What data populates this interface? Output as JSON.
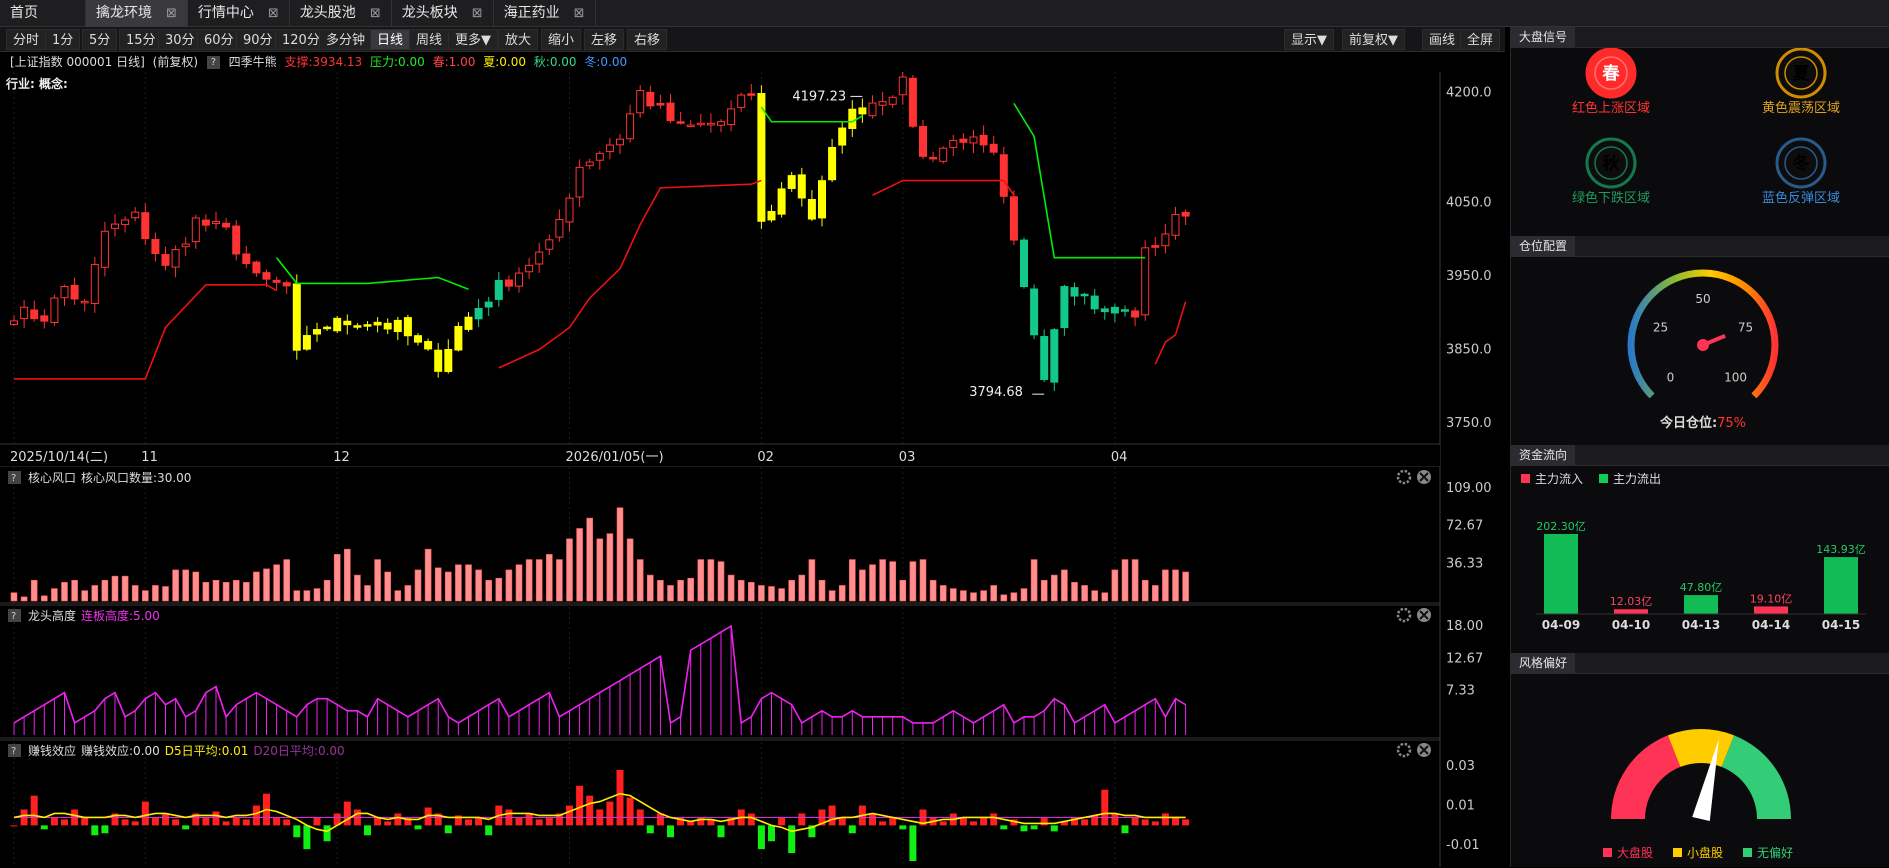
{
  "tabs": [
    {
      "label": "首页",
      "close": false,
      "active": false
    },
    {
      "label": "擒龙环境",
      "close": true,
      "active": true
    },
    {
      "label": "行情中心",
      "close": true,
      "active": false
    },
    {
      "label": "龙头股池",
      "close": true,
      "active": false
    },
    {
      "label": "龙头板块",
      "close": true,
      "active": false
    },
    {
      "label": "海正药业",
      "close": true,
      "active": false
    }
  ],
  "toolbar": {
    "periods": [
      "分时",
      "1分",
      "5分",
      "15分",
      "30分",
      "60分",
      "90分",
      "120分",
      "多分钟",
      "日线",
      "周线",
      "更多▼"
    ],
    "active_period": "日线",
    "actions": [
      "放大",
      "缩小",
      "左移",
      "右移"
    ],
    "right": [
      "显示▼",
      "前复权▼",
      "画线",
      "全屏"
    ]
  },
  "info": {
    "title": "[上证指数 000001 日线]",
    "adjust": "(前复权)",
    "indicator": "四季牛熊",
    "support": "支撑:3934.13",
    "pressure": "压力:0.00",
    "spring": "春:1.00",
    "summer": "夏:0.00",
    "autumn": "秋:0.00",
    "winter": "冬:0.00"
  },
  "colors": {
    "up": "#ff3333",
    "down": "#13c98a",
    "yellow": "#ffff00",
    "green_line": "#00ee00",
    "red_line": "#ee1111",
    "magenta": "#ee22ee",
    "vol": "#ff8f8f"
  },
  "chart_data": [
    {
      "type": "candlestick",
      "name": "main",
      "corner_label": "行业: 概念:",
      "ylim": [
        3735,
        4225
      ],
      "y_ticks": [
        "4200.0",
        "4050.0",
        "3950.0",
        "3850.0",
        "3750.0"
      ],
      "y_tick_values": [
        4200,
        4050,
        3950,
        3850,
        3750
      ],
      "x_labels": [
        {
          "i": 0,
          "label": "2025/10/14(二)"
        },
        {
          "i": 13,
          "label": "11"
        },
        {
          "i": 32,
          "label": "12"
        },
        {
          "i": 55,
          "label": "2026/01/05(一)"
        },
        {
          "i": 74,
          "label": "02"
        },
        {
          "i": 88,
          "label": "03"
        },
        {
          "i": 109,
          "label": "04"
        }
      ],
      "annotations": [
        {
          "i": 84,
          "price": 4197.23,
          "label": "4197.23"
        },
        {
          "i": 102,
          "price": 3794.68,
          "label": "3794.68"
        }
      ],
      "count": 117,
      "anchors": [
        [
          0,
          3900
        ],
        [
          3,
          3895
        ],
        [
          5,
          3935
        ],
        [
          7,
          3910
        ],
        [
          9,
          4010
        ],
        [
          12,
          4030
        ],
        [
          15,
          3960
        ],
        [
          18,
          4025
        ],
        [
          21,
          4010
        ],
        [
          24,
          3945
        ],
        [
          27,
          3935
        ],
        [
          28,
          3840
        ],
        [
          30,
          3880
        ],
        [
          34,
          3890
        ],
        [
          38,
          3880
        ],
        [
          42,
          3830
        ],
        [
          44,
          3880
        ],
        [
          48,
          3935
        ],
        [
          53,
          3990
        ],
        [
          56,
          4100
        ],
        [
          60,
          4140
        ],
        [
          62,
          4200
        ],
        [
          66,
          4150
        ],
        [
          70,
          4160
        ],
        [
          73,
          4200
        ],
        [
          74,
          4020
        ],
        [
          77,
          4090
        ],
        [
          79,
          4030
        ],
        [
          82,
          4160
        ],
        [
          84,
          4180
        ],
        [
          88,
          4210
        ],
        [
          90,
          4110
        ],
        [
          94,
          4140
        ],
        [
          97,
          4110
        ],
        [
          100,
          3930
        ],
        [
          102,
          3820
        ],
        [
          104,
          3945
        ],
        [
          108,
          3900
        ],
        [
          111,
          3900
        ],
        [
          112,
          3980
        ],
        [
          116,
          4040
        ]
      ],
      "four_season": [
        [
          0,
          62,
          3810
        ],
        [
          9,
          9,
          3900
        ],
        [
          12,
          22,
          3940
        ],
        [
          27,
          27,
          3960
        ],
        [
          29,
          45,
          3940
        ],
        [
          48,
          57,
          3855
        ],
        [
          62,
          70,
          4070
        ],
        [
          74,
          74,
          4070
        ],
        [
          75,
          84,
          4185
        ],
        [
          85,
          95,
          4080
        ],
        [
          96,
          96,
          4040
        ],
        [
          100,
          112,
          3960
        ],
        [
          113,
          116,
          3845
        ]
      ]
    },
    {
      "type": "bar",
      "name": "核心风口",
      "label": "核心风口",
      "sub": "核心风口数量:30.00",
      "ylim": [
        0,
        110
      ],
      "y_ticks": [
        "109.00",
        "72.67",
        "36.33"
      ],
      "y_tick_values": [
        109,
        72.67,
        36.33
      ],
      "values": [
        8,
        4,
        20,
        5,
        12,
        18,
        20,
        10,
        15,
        20,
        24,
        24,
        15,
        10,
        15,
        14,
        30,
        30,
        28,
        18,
        20,
        18,
        20,
        18,
        28,
        31,
        35,
        40,
        10,
        10,
        12,
        20,
        45,
        50,
        25,
        15,
        40,
        28,
        10,
        15,
        30,
        50,
        32,
        28,
        35,
        35,
        30,
        20,
        22,
        30,
        35,
        40,
        40,
        45,
        40,
        60,
        70,
        80,
        60,
        65,
        90,
        60,
        40,
        25,
        20,
        15,
        20,
        22,
        40,
        40,
        38,
        25,
        20,
        18,
        15,
        14,
        12,
        20,
        25,
        40,
        20,
        10,
        15,
        40,
        30,
        35,
        40,
        38,
        20,
        38,
        40,
        20,
        15,
        12,
        10,
        8,
        10,
        15,
        6,
        8,
        12,
        40,
        20,
        25,
        30,
        18,
        15,
        10,
        8,
        30,
        40,
        40,
        20,
        15,
        30,
        30,
        28
      ]
    },
    {
      "type": "line",
      "name": "龙头高度",
      "label": "龙头高度",
      "sub": "连板高度:5.00",
      "ylim": [
        0,
        18.5
      ],
      "y_ticks": [
        "18.00",
        "12.67",
        "7.33"
      ],
      "y_tick_values": [
        18,
        12.67,
        7.33
      ],
      "values": [
        2,
        3,
        4,
        5,
        6,
        7,
        2,
        3,
        4,
        6,
        7,
        3,
        4,
        6,
        7,
        5,
        6,
        3,
        4,
        7,
        8,
        3,
        5,
        6,
        7,
        6,
        5,
        4,
        3,
        5,
        6,
        6,
        5,
        4,
        4,
        3,
        6,
        5,
        4,
        3,
        4,
        5,
        6,
        3,
        2,
        3,
        4,
        5,
        6,
        3,
        4,
        5,
        6,
        7,
        3,
        4,
        5,
        6,
        7,
        8,
        9,
        10,
        11,
        12,
        13,
        2,
        3,
        14,
        15,
        16,
        17,
        18,
        2,
        3,
        6,
        7,
        6,
        5,
        2,
        3,
        4,
        3,
        3,
        4,
        3,
        3,
        3,
        3,
        3,
        2,
        2,
        2,
        3,
        4,
        3,
        2,
        3,
        4,
        5,
        2,
        3,
        3,
        4,
        6,
        5,
        2,
        3,
        4,
        5,
        2,
        3,
        4,
        5,
        6,
        3,
        6,
        5
      ]
    },
    {
      "type": "bar",
      "name": "赚钱效应",
      "label": "赚钱效应",
      "sub": "赚钱效应:0.00",
      "d5": "D5日平均:0.01",
      "d20": "D20日平均:0.00",
      "ylim": [
        -0.02,
        0.034
      ],
      "y_ticks": [
        "0.03",
        "0.01",
        "-0.01"
      ],
      "y_tick_values": [
        0.03,
        0.01,
        -0.01
      ],
      "values": [
        0.0,
        0.008,
        0.015,
        -0.002,
        0.004,
        0.003,
        0.008,
        0.004,
        -0.005,
        -0.004,
        0.006,
        0.003,
        0.002,
        0.012,
        0.004,
        0.006,
        0.003,
        -0.002,
        0.006,
        0.004,
        0.007,
        0.002,
        0.004,
        0.003,
        0.01,
        0.016,
        0.004,
        0.003,
        -0.006,
        -0.012,
        0.004,
        -0.008,
        0.006,
        0.012,
        0.008,
        -0.005,
        0.004,
        0.002,
        0.006,
        0.004,
        -0.002,
        0.009,
        0.006,
        -0.004,
        0.005,
        0.003,
        0.004,
        -0.005,
        0.01,
        0.008,
        0.004,
        0.006,
        0.003,
        0.004,
        0.006,
        0.01,
        0.02,
        0.015,
        0.008,
        0.012,
        0.028,
        0.014,
        0.008,
        -0.004,
        0.006,
        -0.006,
        0.004,
        0.002,
        0.004,
        0.003,
        -0.006,
        0.004,
        0.008,
        0.006,
        -0.012,
        -0.008,
        0.004,
        -0.014,
        0.006,
        -0.006,
        0.008,
        0.01,
        0.004,
        -0.004,
        0.01,
        0.006,
        0.002,
        0.004,
        -0.002,
        -0.018,
        0.008,
        0.004,
        0.002,
        0.006,
        0.004,
        0.002,
        0.004,
        0.006,
        -0.002,
        0.003,
        -0.003,
        -0.002,
        0.004,
        -0.003,
        0.002,
        0.004,
        0.003,
        0.005,
        0.018,
        0.006,
        -0.004,
        0.004,
        0.003,
        0.002,
        0.006,
        0.004,
        0.003
      ],
      "d5_values": [
        0.004,
        0.005,
        0.005,
        0.004,
        0.006,
        0.006,
        0.005,
        0.004,
        0.004,
        0.004,
        0.005,
        0.005,
        0.004,
        0.005,
        0.006,
        0.006,
        0.005,
        0.004,
        0.005,
        0.005,
        0.005,
        0.004,
        0.005,
        0.005,
        0.006,
        0.008,
        0.007,
        0.005,
        0.003,
        0.0,
        -0.002,
        -0.003,
        0.0,
        0.003,
        0.006,
        0.006,
        0.004,
        0.003,
        0.004,
        0.003,
        0.003,
        0.005,
        0.005,
        0.004,
        0.004,
        0.004,
        0.004,
        0.003,
        0.005,
        0.006,
        0.006,
        0.006,
        0.005,
        0.005,
        0.005,
        0.007,
        0.009,
        0.011,
        0.012,
        0.014,
        0.016,
        0.015,
        0.012,
        0.009,
        0.006,
        0.004,
        0.003,
        0.002,
        0.003,
        0.003,
        0.002,
        0.003,
        0.004,
        0.004,
        0.002,
        0.0,
        -0.001,
        -0.003,
        -0.002,
        -0.001,
        0.001,
        0.003,
        0.004,
        0.004,
        0.005,
        0.006,
        0.005,
        0.004,
        0.003,
        0.002,
        0.001,
        0.002,
        0.003,
        0.003,
        0.004,
        0.004,
        0.004,
        0.004,
        0.003,
        0.002,
        0.001,
        0.001,
        0.001,
        0.001,
        0.002,
        0.003,
        0.004,
        0.005,
        0.006,
        0.006,
        0.005,
        0.005,
        0.004,
        0.004,
        0.004,
        0.004,
        0.004
      ],
      "d20_value": 0.004
    }
  ],
  "right": {
    "signal": {
      "title": "大盘信号",
      "items": [
        {
          "glyph": "春",
          "label": "红色上涨区域",
          "color": "#ff2b2b",
          "active": true
        },
        {
          "glyph": "夏",
          "label": "黄色震荡区域",
          "color": "#d08b00",
          "active": false
        },
        {
          "glyph": "秋",
          "label": "绿色下跌区域",
          "color": "#137a4e",
          "active": false
        },
        {
          "glyph": "冬",
          "label": "蓝色反弹区域",
          "color": "#2a5a8c",
          "active": false
        }
      ]
    },
    "position": {
      "title": "仓位配置",
      "ticks": [
        "0",
        "25",
        "50",
        "75",
        "100"
      ],
      "value": 75,
      "label": "今日仓位:",
      "value_text": "75%"
    },
    "flow": {
      "title": "资金流向",
      "legend_in": "主力流入",
      "legend_out": "主力流出",
      "bars": [
        {
          "date": "04-09",
          "value": 202.3,
          "label": "202.30亿",
          "dir": "out"
        },
        {
          "date": "04-10",
          "value": 12.03,
          "label": "12.03亿",
          "dir": "in"
        },
        {
          "date": "04-13",
          "value": 47.8,
          "label": "47.80亿",
          "dir": "out"
        },
        {
          "date": "04-14",
          "value": 19.1,
          "label": "19.10亿",
          "dir": "in"
        },
        {
          "date": "04-15",
          "value": 143.93,
          "label": "143.93亿",
          "dir": "out"
        }
      ]
    },
    "style": {
      "title": "风格偏好",
      "legend": [
        {
          "label": "大盘股",
          "color": "#ff3355"
        },
        {
          "label": "小盘股",
          "color": "#ffcc00"
        },
        {
          "label": "无偏好",
          "color": "#33cc77"
        }
      ],
      "needle": 0.57
    }
  }
}
